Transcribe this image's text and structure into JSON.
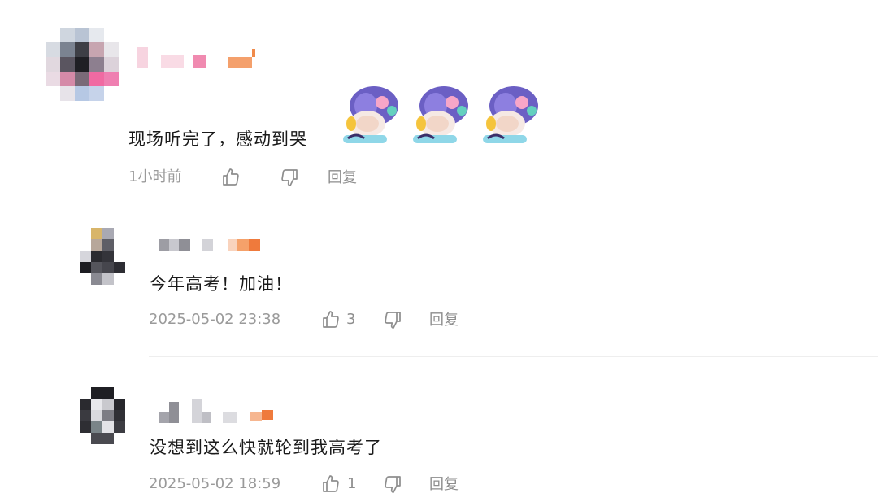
{
  "comments": [
    {
      "text": "现场听完了，感动到哭",
      "time": "1小时前",
      "like_count": "",
      "reply_label": "回复",
      "sticker_count": 3
    },
    {
      "text": "今年高考！加油！",
      "time": "2025-05-02 23:38",
      "like_count": "3",
      "reply_label": "回复"
    },
    {
      "text": "没想到这么快就轮到我高考了",
      "time": "2025-05-02 18:59",
      "like_count": "1",
      "reply_label": "回复"
    }
  ],
  "colors": {
    "text": "#1a1a1a",
    "meta": "#9a9a9a",
    "name_accent": "#f0783a",
    "divider": "#eeeeee"
  }
}
